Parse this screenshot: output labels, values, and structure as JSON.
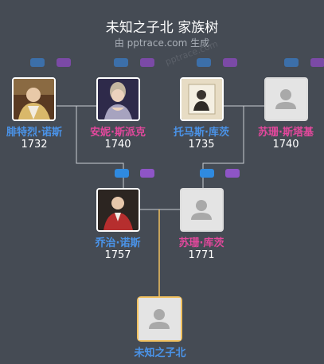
{
  "title": "未知之子北 家族树",
  "subtitle": "由 pptrace.com 生成",
  "watermark": "pptrace.com",
  "colors": {
    "background": "#454b54",
    "male": "#4a93e8",
    "female": "#e2489c",
    "line": "#c9cdd2",
    "self_line": "#f2c260"
  },
  "people": [
    {
      "name": "腓特烈·诺斯",
      "year": "1732",
      "gender": "male",
      "photo": "portrait-icon"
    },
    {
      "name": "安妮·斯派克",
      "year": "1740",
      "gender": "female",
      "photo": "portrait-icon"
    },
    {
      "name": "托马斯·库茨",
      "year": "1735",
      "gender": "male",
      "photo": "portrait-icon"
    },
    {
      "name": "苏珊·斯塔基",
      "year": "1740",
      "gender": "female",
      "photo": "person-placeholder-icon"
    },
    {
      "name": "乔治·诺斯",
      "year": "1757",
      "gender": "male",
      "photo": "portrait-icon"
    },
    {
      "name": "苏珊·库茨",
      "year": "1771",
      "gender": "female",
      "photo": "person-placeholder-icon"
    }
  ],
  "self": {
    "name": "未知之子北",
    "photo": "person-placeholder-icon"
  }
}
